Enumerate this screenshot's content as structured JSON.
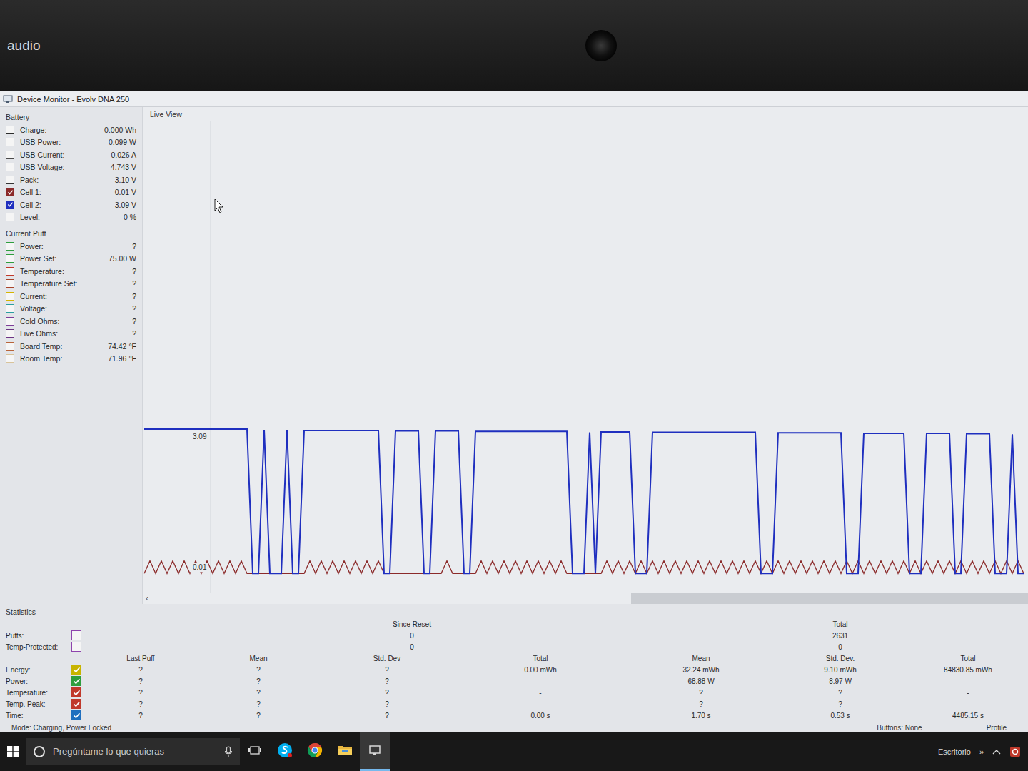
{
  "desktop": {
    "label": "audio"
  },
  "window": {
    "title": "Device Monitor - Evolv DNA 250"
  },
  "sections": [
    {
      "title": "Battery",
      "rows": [
        {
          "label": "Charge:",
          "value": "0.000 Wh",
          "checked": false,
          "color": "#2b2b2b"
        },
        {
          "label": "USB Power:",
          "value": "0.099 W",
          "checked": false,
          "color": "#3d3d3d"
        },
        {
          "label": "USB Current:",
          "value": "0.026 A",
          "checked": false,
          "color": "#4a4a4a"
        },
        {
          "label": "USB Voltage:",
          "value": "4.743 V",
          "checked": false,
          "color": "#3a3a3a"
        },
        {
          "label": "Pack:",
          "value": "3.10 V",
          "checked": false,
          "color": "#333333"
        },
        {
          "label": "Cell 1:",
          "value": "0.01 V",
          "checked": true,
          "color": "#8b2a2a"
        },
        {
          "label": "Cell 2:",
          "value": "3.09 V",
          "checked": true,
          "color": "#1f2fbf"
        },
        {
          "label": "Level:",
          "value": "0 %",
          "checked": false,
          "color": "#333333"
        }
      ]
    },
    {
      "title": "Current Puff",
      "rows": [
        {
          "label": "Power:",
          "value": "?",
          "checked": false,
          "color": "#2e9e3e"
        },
        {
          "label": "Power Set:",
          "value": "75.00 W",
          "checked": false,
          "color": "#2e9e3e"
        },
        {
          "label": "Temperature:",
          "value": "?",
          "checked": false,
          "color": "#c0392b"
        },
        {
          "label": "Temperature Set:",
          "value": "?",
          "checked": false,
          "color": "#a8452a"
        },
        {
          "label": "Current:",
          "value": "?",
          "checked": false,
          "color": "#d4b400"
        },
        {
          "label": "Voltage:",
          "value": "?",
          "checked": false,
          "color": "#2a9fa0"
        },
        {
          "label": "Cold Ohms:",
          "value": "?",
          "checked": false,
          "color": "#7d3c98"
        },
        {
          "label": "Live Ohms:",
          "value": "?",
          "checked": false,
          "color": "#6c3483"
        },
        {
          "label": "Board Temp:",
          "value": "74.42 °F",
          "checked": false,
          "color": "#b8643a"
        },
        {
          "label": "Room Temp:",
          "value": "71.96 °F",
          "checked": false,
          "color": "#d8c39a"
        }
      ]
    }
  ],
  "chart": {
    "title": "Live View",
    "scroll_left": "‹",
    "ticks": [
      {
        "label": "3.09",
        "value": 3.09
      },
      {
        "label": "0.01",
        "value": 0.01
      }
    ],
    "scroll": {
      "level": 0.45
    },
    "series": [
      {
        "name": "Cell 1",
        "color": "#8b2a2a",
        "values": [
          0.01,
          0.28,
          0.01,
          0.28,
          0.01,
          0.28,
          0.01,
          0.28,
          0.01,
          0.28,
          0.01,
          0.28,
          0.01,
          0.28,
          0.01,
          0.28,
          0.01,
          0.28,
          0.01,
          0.01,
          0.01,
          0.01,
          0.01,
          0.01,
          0.01,
          0.01,
          0.01,
          0.01,
          0.01,
          0.28,
          0.01,
          0.28,
          0.01,
          0.28,
          0.01,
          0.28,
          0.01,
          0.28,
          0.01,
          0.28,
          0.01,
          0.28,
          0.01,
          0.01,
          0.01,
          0.01,
          0.01,
          0.01,
          0.01,
          0.01,
          0.01,
          0.01,
          0.01,
          0.28,
          0.01,
          0.01,
          0.01,
          0.01,
          0.01,
          0.28,
          0.01,
          0.28,
          0.01,
          0.28,
          0.01,
          0.28,
          0.01,
          0.28,
          0.01,
          0.28,
          0.01,
          0.28,
          0.01,
          0.28,
          0.01,
          0.01,
          0.01,
          0.01,
          0.01,
          0.01,
          0.01,
          0.28,
          0.01,
          0.28,
          0.01,
          0.28,
          0.01,
          0.28,
          0.01,
          0.28,
          0.01,
          0.28,
          0.01,
          0.28,
          0.01,
          0.28,
          0.01,
          0.28,
          0.01,
          0.28,
          0.01,
          0.28,
          0.01,
          0.28,
          0.01,
          0.28,
          0.01,
          0.28,
          0.01,
          0.28,
          0.01,
          0.28,
          0.01,
          0.28,
          0.01,
          0.28,
          0.01,
          0.28,
          0.01,
          0.28,
          0.01,
          0.28,
          0.01,
          0.28,
          0.01,
          0.28,
          0.01,
          0.28,
          0.01,
          0.28,
          0.01,
          0.28,
          0.01,
          0.28,
          0.01,
          0.28,
          0.01,
          0.28,
          0.01,
          0.28,
          0.01,
          0.28,
          0.01,
          0.28,
          0.01,
          0.28,
          0.01,
          0.28,
          0.01,
          0.28,
          0.01,
          0.28,
          0.01,
          0.28,
          0.01
        ]
      },
      {
        "name": "Cell 2",
        "color": "#1f2fbf",
        "values": [
          3.09,
          3.09,
          3.09,
          3.09,
          3.09,
          3.09,
          3.09,
          3.09,
          3.09,
          3.09,
          3.09,
          3.09,
          3.09,
          3.09,
          3.09,
          3.09,
          3.09,
          3.09,
          3.09,
          0.01,
          0.01,
          3.07,
          0.01,
          0.01,
          0.01,
          3.07,
          0.01,
          0.01,
          3.06,
          3.06,
          3.06,
          3.06,
          3.06,
          3.06,
          3.06,
          3.06,
          3.06,
          3.06,
          3.06,
          3.06,
          3.06,
          3.06,
          0.01,
          0.01,
          3.05,
          3.05,
          3.05,
          3.05,
          3.05,
          0.01,
          0.01,
          3.05,
          3.05,
          3.05,
          3.05,
          3.05,
          0.01,
          0.01,
          3.04,
          3.04,
          3.04,
          3.04,
          3.04,
          3.04,
          3.04,
          3.04,
          3.04,
          3.04,
          3.04,
          3.04,
          3.04,
          3.04,
          3.04,
          3.04,
          3.04,
          0.01,
          0.01,
          0.01,
          3.02,
          0.01,
          3.03,
          3.03,
          3.03,
          3.03,
          3.03,
          3.03,
          0.01,
          0.01,
          0.01,
          3.02,
          3.02,
          3.02,
          3.02,
          3.02,
          3.02,
          3.02,
          3.02,
          3.02,
          3.02,
          3.02,
          3.02,
          3.02,
          3.02,
          3.02,
          3.02,
          3.02,
          3.02,
          3.02,
          0.01,
          0.01,
          0.01,
          3.01,
          3.01,
          3.01,
          3.01,
          3.01,
          3.01,
          3.01,
          3.01,
          3.01,
          3.01,
          3.01,
          3.01,
          0.01,
          0.01,
          0.01,
          3.0,
          3.0,
          3.0,
          3.0,
          3.0,
          3.0,
          3.0,
          3.0,
          0.01,
          0.01,
          0.01,
          3.0,
          3.0,
          3.0,
          3.0,
          3.0,
          0.01,
          0.01,
          2.99,
          2.99,
          2.99,
          2.99,
          2.99,
          0.01,
          0.01,
          0.01,
          2.98,
          0.01,
          0.01
        ]
      }
    ]
  },
  "statistics": {
    "title": "Statistics",
    "since_reset_label": "Since Reset",
    "total_label": "Total",
    "counters": [
      {
        "label": "Puffs:",
        "checked": false,
        "color": "#8e44ad",
        "since_reset": "0",
        "total": "2631"
      },
      {
        "label": "Temp-Protected:",
        "checked": false,
        "color": "#8e44ad",
        "since_reset": "0",
        "total": "0"
      }
    ],
    "columns": [
      "Last Puff",
      "Mean",
      "Std. Dev",
      "Total",
      "Mean",
      "Std. Dev.",
      "Total"
    ],
    "rows": [
      {
        "label": "Energy:",
        "checked": true,
        "color": "#c8b400",
        "values": [
          "?",
          "?",
          "?",
          "0.00 mWh",
          "32.24 mWh",
          "9.10 mWh",
          "84830.85 mWh"
        ]
      },
      {
        "label": "Power:",
        "checked": true,
        "color": "#2e9e3e",
        "values": [
          "?",
          "?",
          "?",
          "-",
          "68.88 W",
          "8.97 W",
          "-"
        ]
      },
      {
        "label": "Temperature:",
        "checked": true,
        "color": "#c0392b",
        "values": [
          "?",
          "?",
          "?",
          "-",
          "?",
          "?",
          "-"
        ]
      },
      {
        "label": "Temp. Peak:",
        "checked": true,
        "color": "#c0392b",
        "values": [
          "?",
          "?",
          "?",
          "-",
          "?",
          "?",
          "-"
        ]
      },
      {
        "label": "Time:",
        "checked": true,
        "color": "#1f6fbf",
        "values": [
          "?",
          "?",
          "?",
          "0.00 s",
          "1.70 s",
          "0.53 s",
          "4485.15 s"
        ]
      }
    ]
  },
  "status": {
    "mode": "Mode: Charging, Power Locked",
    "buttons": "Buttons: None",
    "profile": "Profile"
  },
  "taskbar": {
    "search_placeholder": "Pregúntame lo que quieras",
    "tray_label": "Escritorio",
    "tray_more": "»",
    "apps": [
      {
        "kind": "skype",
        "active": false
      },
      {
        "kind": "chrome",
        "active": false
      },
      {
        "kind": "explorer",
        "active": false
      },
      {
        "kind": "monitor",
        "active": true
      }
    ]
  }
}
